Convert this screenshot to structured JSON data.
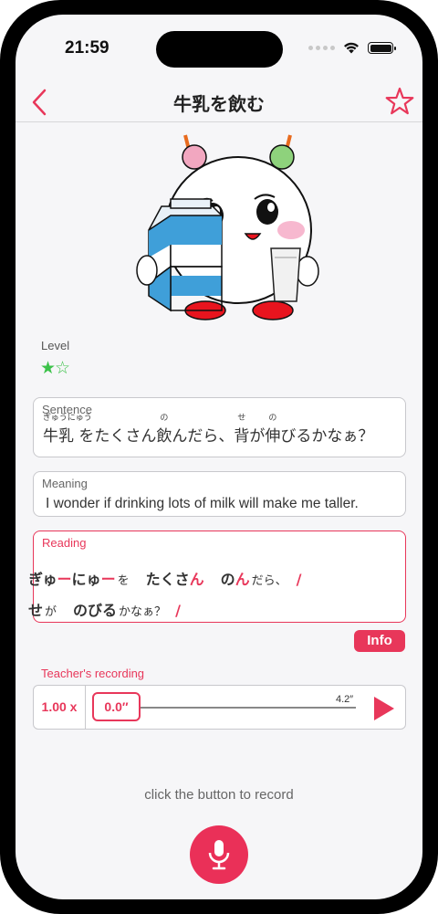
{
  "status": {
    "time": "21:59"
  },
  "nav": {
    "title": "牛乳を飲む"
  },
  "level": {
    "label": "Level",
    "stars_filled": 1,
    "stars_total": 2,
    "full": "★",
    "empty": "☆"
  },
  "sentence": {
    "label": "Sentence",
    "segments": [
      {
        "text": "牛乳",
        "ruby": "ぎゅうにゅう"
      },
      {
        "text": " をたくさん"
      },
      {
        "text": "飲",
        "ruby": "の"
      },
      {
        "text": "んだら、"
      },
      {
        "text": "背",
        "ruby": "せ"
      },
      {
        "text": "が"
      },
      {
        "text": "伸",
        "ruby": "の"
      },
      {
        "text": "びるかなぁ？"
      }
    ]
  },
  "meaning": {
    "label": "Meaning",
    "text": "I wonder if drinking lots of milk will make me taller."
  },
  "reading": {
    "label": "Reading",
    "line1": {
      "w1a": "ぎゅ",
      "w1b": "ー",
      "w1c": "にゅ",
      "w1d": "ー",
      "w1p": "を",
      "w2a": "たくさ",
      "w2b": "ん",
      "w3a": "の",
      "w3b": "ん",
      "w3p": "だら、",
      "slash": "/"
    },
    "line2": {
      "w1": "せ",
      "w1p": "が",
      "w2": "のびる",
      "w2p": "かなぁ？",
      "slash": "/"
    }
  },
  "info_button": "Info",
  "recording": {
    "label": "Teacher's recording",
    "speed": "1.00 x",
    "position": "0.0″",
    "duration": "4.2″",
    "progress": 0
  },
  "hint": "click the button to record",
  "colors": {
    "accent": "#e8375a",
    "star": "#3cc24a",
    "background": "#f6f6f8"
  },
  "icons": {
    "back": "chevron-left-icon",
    "favorite": "star-outline-icon",
    "play": "play-icon",
    "mic": "microphone-icon"
  }
}
